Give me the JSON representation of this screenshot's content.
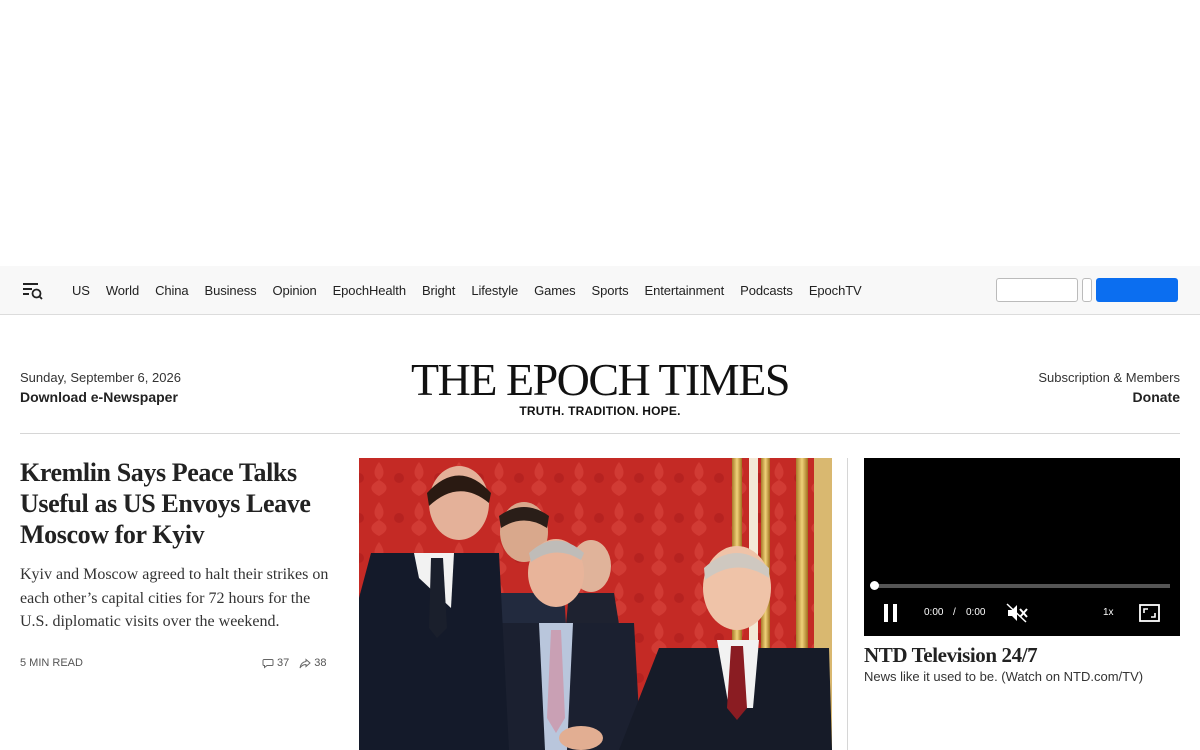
{
  "nav": {
    "items": [
      "US",
      "World",
      "China",
      "Business",
      "Opinion",
      "EpochHealth",
      "Bright",
      "Lifestyle",
      "Games",
      "Sports",
      "Entertainment",
      "Podcasts",
      "EpochTV"
    ],
    "login_label": "",
    "subscribe_label": ""
  },
  "masthead": {
    "date": "Sunday, September 6, 2026",
    "enewspaper": "Download e-Newspaper",
    "logo": "THE EPOCH TIMES",
    "tagline": "TRUTH. TRADITION. HOPE.",
    "subscription": "Subscription & Members",
    "donate": "Donate"
  },
  "lead": {
    "headline": "Kremlin Says Peace Talks Useful as US Envoys Leave Moscow for Kyiv",
    "summary": "Kyiv and Moscow agreed to halt their strikes on each other’s capital cities for 72 hours for the U.S. diplomatic visits over the weekend.",
    "read_time": "5 MIN READ",
    "comments": "37",
    "shares": "38"
  },
  "video": {
    "current_time": "0:00",
    "separator": "/",
    "duration": "0:00",
    "speed": "1x",
    "progress": 0,
    "title": "NTD Television 24/7",
    "subtitle": "News like it used to be. (Watch on NTD.com/TV)"
  },
  "colors": {
    "accent": "#0b6ef0",
    "nav_bg": "#f8f8f8",
    "video_bg": "#000000",
    "photo_bg": "#c42a25"
  },
  "icons": {
    "menu": "menu-search-icon",
    "comment": "comment-icon",
    "share": "share-icon",
    "pause": "pause-icon",
    "mute": "muted-speaker-icon",
    "fullscreen": "fullscreen-icon"
  }
}
